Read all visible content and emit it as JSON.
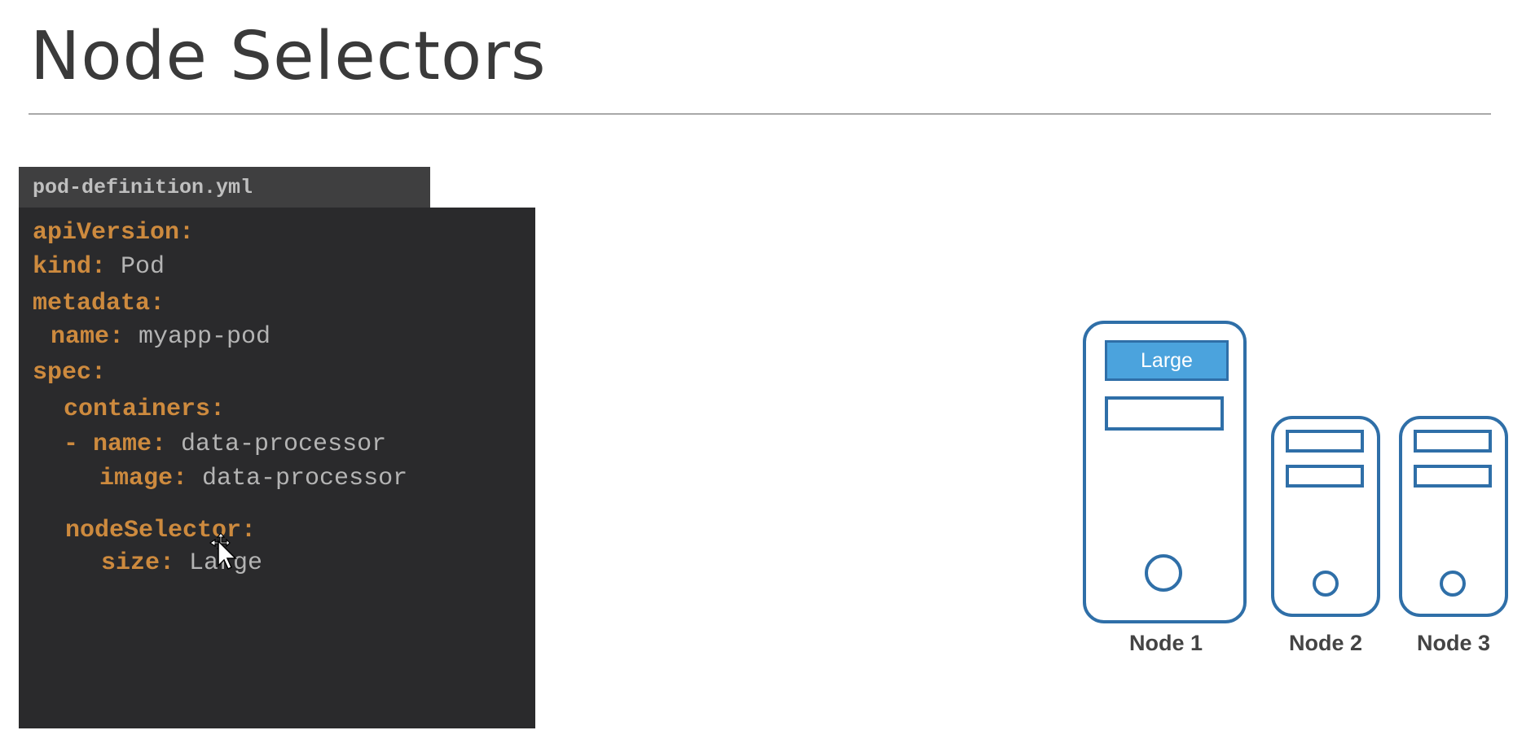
{
  "slide": {
    "title": "Node Selectors"
  },
  "file": {
    "name": "pod-definition.yml"
  },
  "code": {
    "lines": [
      {
        "key": "apiVersion:",
        "value": ""
      },
      {
        "key": "kind:",
        "value": " Pod"
      },
      {
        "key": "metadata:",
        "value": ""
      },
      {
        "key": "name:",
        "value": " myapp-pod"
      },
      {
        "key": "spec:",
        "value": ""
      },
      {
        "key": "containers:",
        "value": ""
      },
      {
        "key": "- name:",
        "value": " data-processor"
      },
      {
        "key": "image:",
        "value": " data-processor"
      },
      {
        "key": "nodeSelector:",
        "value": ""
      },
      {
        "key": "size:",
        "value": " Large"
      }
    ]
  },
  "nodes": [
    {
      "label": "Node 1",
      "tag": "Large"
    },
    {
      "label": "Node 2"
    },
    {
      "label": "Node 3"
    }
  ],
  "colors": {
    "yaml_key": "#cd8a3e",
    "yaml_value": "#b4b4b4",
    "code_bg": "#2a2a2c",
    "server_outline": "#2f6fa8",
    "label_fill": "#4ba3dd"
  },
  "icons": [
    "move-cursor-icon",
    "server-icon"
  ]
}
